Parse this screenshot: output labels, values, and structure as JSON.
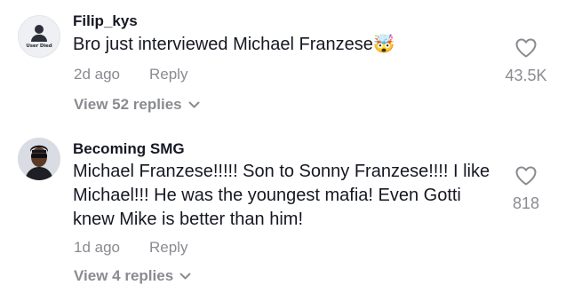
{
  "comments": [
    {
      "username": "Filip_kys",
      "avatar_label": "User Died",
      "text_lines": [
        "Bro just interviewed Michael Franzese🤯"
      ],
      "time": "2d ago",
      "reply_label": "Reply",
      "likes": "43.5K",
      "view_replies": "View 52 replies"
    },
    {
      "username": "Becoming SMG",
      "text_lines": [
        "Michael Franzese!!!!! Son to Sonny Franzese!!!! I like",
        "Michael!!! He was the youngest mafia! Even Gotti",
        "knew Mike is better than him!"
      ],
      "time": "1d ago",
      "reply_label": "Reply",
      "likes": "818",
      "view_replies": "View 4 replies"
    }
  ],
  "icons": {
    "like": "heart-outline-icon",
    "expand": "chevron-down-icon"
  },
  "colors": {
    "text": "#161823",
    "muted": "#8a8b91"
  }
}
